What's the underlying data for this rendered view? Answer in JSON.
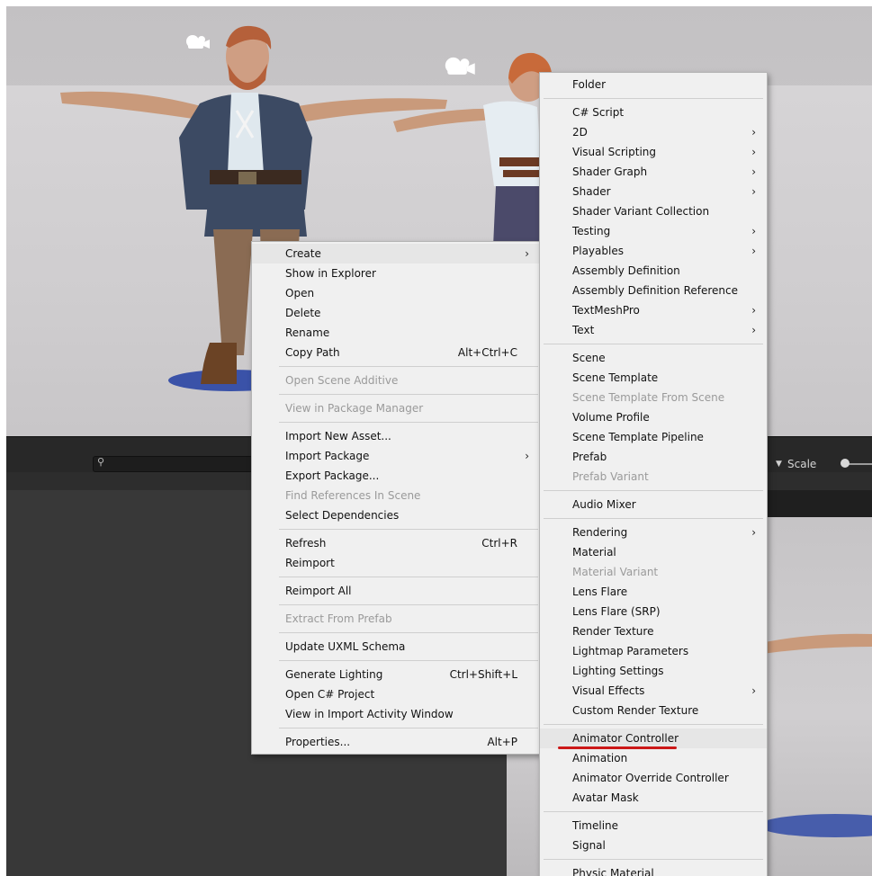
{
  "scene_toolbar": {
    "search_placeholder": "",
    "scale_label": "Scale"
  },
  "icons": {
    "camera": "camera-gizmo-icon",
    "search": "search-icon",
    "arrow": "chevron-right-icon"
  },
  "context_menu": {
    "items": [
      {
        "label": "Create",
        "arrow": "›",
        "highlighted": true
      },
      {
        "label": "Show in Explorer"
      },
      {
        "label": "Open"
      },
      {
        "label": "Delete"
      },
      {
        "label": "Rename"
      },
      {
        "label": "Copy Path",
        "shortcut": "Alt+Ctrl+C"
      },
      {
        "separator": true
      },
      {
        "label": "Open Scene Additive",
        "disabled": true
      },
      {
        "separator": true
      },
      {
        "label": "View in Package Manager",
        "disabled": true
      },
      {
        "separator": true
      },
      {
        "label": "Import New Asset..."
      },
      {
        "label": "Import Package",
        "arrow": "›"
      },
      {
        "label": "Export Package..."
      },
      {
        "label": "Find References In Scene",
        "disabled": true
      },
      {
        "label": "Select Dependencies"
      },
      {
        "separator": true
      },
      {
        "label": "Refresh",
        "shortcut": "Ctrl+R"
      },
      {
        "label": "Reimport"
      },
      {
        "separator": true
      },
      {
        "label": "Reimport All"
      },
      {
        "separator": true
      },
      {
        "label": "Extract From Prefab",
        "disabled": true
      },
      {
        "separator": true
      },
      {
        "label": "Update UXML Schema"
      },
      {
        "separator": true
      },
      {
        "label": "Generate Lighting",
        "shortcut": "Ctrl+Shift+L"
      },
      {
        "label": "Open C# Project"
      },
      {
        "label": "View in Import Activity Window"
      },
      {
        "separator": true
      },
      {
        "label": "Properties...",
        "shortcut": "Alt+P"
      }
    ]
  },
  "create_submenu": {
    "items": [
      {
        "label": "Folder"
      },
      {
        "separator": true
      },
      {
        "label": "C# Script"
      },
      {
        "label": "2D",
        "arrow": "›"
      },
      {
        "label": "Visual Scripting",
        "arrow": "›"
      },
      {
        "label": "Shader Graph",
        "arrow": "›"
      },
      {
        "label": "Shader",
        "arrow": "›"
      },
      {
        "label": "Shader Variant Collection"
      },
      {
        "label": "Testing",
        "arrow": "›"
      },
      {
        "label": "Playables",
        "arrow": "›"
      },
      {
        "label": "Assembly Definition"
      },
      {
        "label": "Assembly Definition Reference"
      },
      {
        "label": "TextMeshPro",
        "arrow": "›"
      },
      {
        "label": "Text",
        "arrow": "›"
      },
      {
        "separator": true
      },
      {
        "label": "Scene"
      },
      {
        "label": "Scene Template"
      },
      {
        "label": "Scene Template From Scene",
        "disabled": true
      },
      {
        "label": "Volume Profile"
      },
      {
        "label": "Scene Template Pipeline"
      },
      {
        "label": "Prefab"
      },
      {
        "label": "Prefab Variant",
        "disabled": true
      },
      {
        "separator": true
      },
      {
        "label": "Audio Mixer"
      },
      {
        "separator": true
      },
      {
        "label": "Rendering",
        "arrow": "›"
      },
      {
        "label": "Material"
      },
      {
        "label": "Material Variant",
        "disabled": true
      },
      {
        "label": "Lens Flare"
      },
      {
        "label": "Lens Flare (SRP)"
      },
      {
        "label": "Render Texture"
      },
      {
        "label": "Lightmap Parameters"
      },
      {
        "label": "Lighting Settings"
      },
      {
        "label": "Visual Effects",
        "arrow": "›"
      },
      {
        "label": "Custom Render Texture"
      },
      {
        "separator": true
      },
      {
        "label": "Animator Controller",
        "highlighted": true,
        "underlined": true
      },
      {
        "label": "Animation"
      },
      {
        "label": "Animator Override Controller"
      },
      {
        "label": "Avatar Mask"
      },
      {
        "separator": true
      },
      {
        "label": "Timeline"
      },
      {
        "label": "Signal"
      },
      {
        "separator": true
      },
      {
        "label": "Physic Material"
      }
    ]
  },
  "colors": {
    "annotation_underline": "#cc1818",
    "menu_bg": "#f0f0f0",
    "character_shadow": "#3a52a8"
  }
}
